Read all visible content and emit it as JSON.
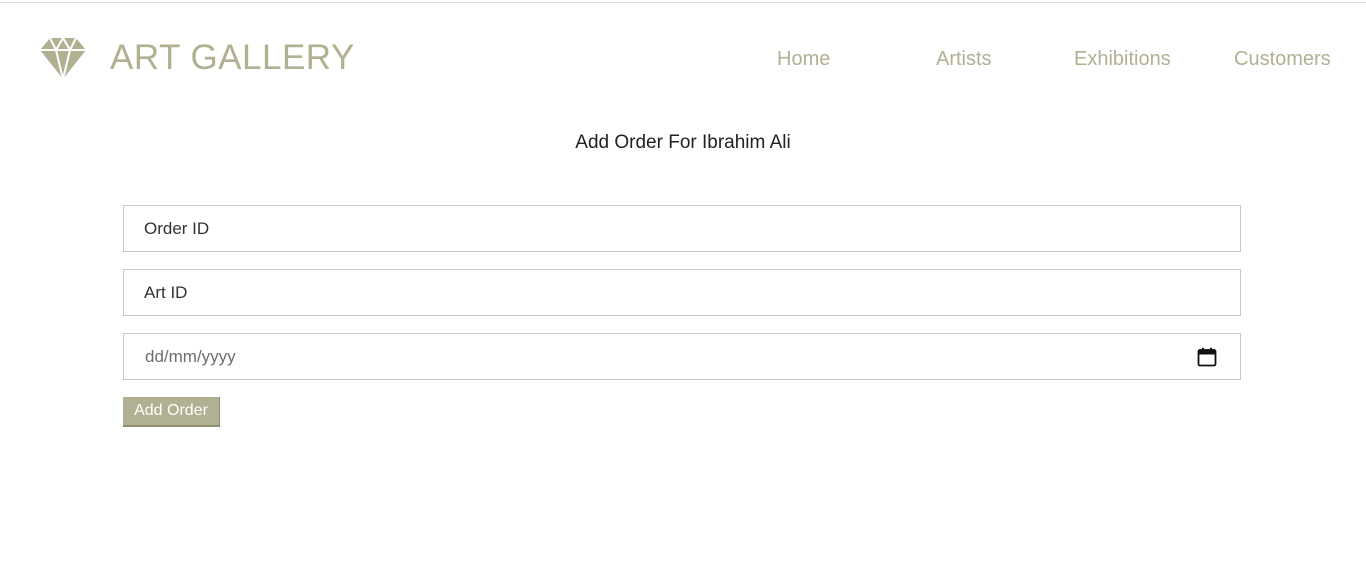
{
  "brand": {
    "name": "ART GALLERY",
    "icon": "diamond-icon",
    "color": "#b1b093"
  },
  "nav": {
    "items": [
      {
        "label": "Home"
      },
      {
        "label": "Artists"
      },
      {
        "label": "Exhibitions"
      },
      {
        "label": "Customers"
      }
    ]
  },
  "form": {
    "heading": "Add Order For Ibrahim Ali",
    "order_id": {
      "placeholder": "Order ID",
      "value": ""
    },
    "art_id": {
      "placeholder": "Art ID",
      "value": ""
    },
    "date": {
      "placeholder": "dd/mm/yyyy",
      "icon": "calendar-icon"
    },
    "submit_label": "Add Order",
    "accent_color": "#b1b093"
  }
}
